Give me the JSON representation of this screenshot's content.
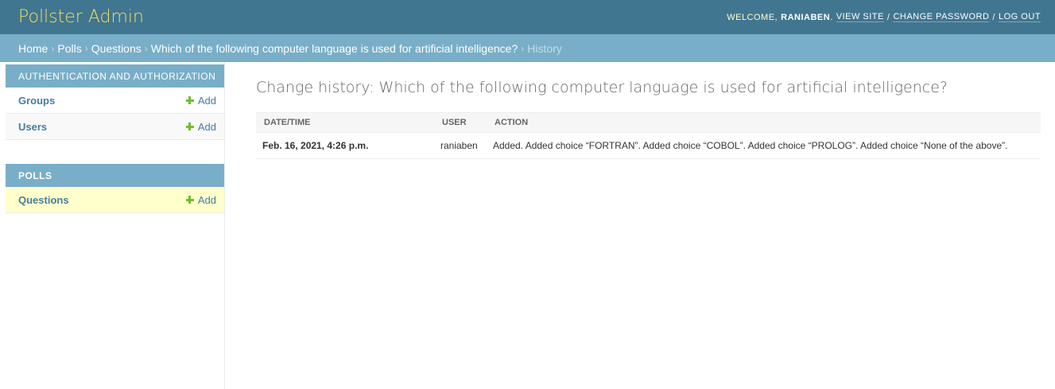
{
  "header": {
    "site_name": "Pollster Admin",
    "welcome": "Welcome,",
    "username": "raniaben",
    "view_site": "View site",
    "change_password": "Change password",
    "log_out": "Log out"
  },
  "breadcrumbs": {
    "home": "Home",
    "polls": "Polls",
    "questions": "Questions",
    "object": "Which of the following computer language is used for artificial intelligence?",
    "current": "History"
  },
  "sidebar": {
    "modules": [
      {
        "caption": "Authentication and Authorization",
        "items": [
          {
            "label": "Groups",
            "add": "Add"
          },
          {
            "label": "Users",
            "add": "Add"
          }
        ]
      },
      {
        "caption": "Polls",
        "items": [
          {
            "label": "Questions",
            "add": "Add"
          }
        ]
      }
    ]
  },
  "content": {
    "title": "Change history: Which of the following computer language is used for artificial intelligence?",
    "columns": [
      "Date/time",
      "User",
      "Action"
    ],
    "rows": [
      {
        "date": "Feb. 16, 2021, 4:26 p.m.",
        "user": "raniaben",
        "action": "Added. Added choice “FORTRAN”. Added choice “COBOL”. Added choice “PROLOG”. Added choice “None of the above”."
      }
    ]
  },
  "colors": {
    "header_bg": "#417690",
    "breadcrumbs_bg": "#79aec8",
    "branding": "#f5dd5d",
    "link": "#447e9b",
    "add_icon": "#70bf2b",
    "current_row": "#ffffcc"
  }
}
